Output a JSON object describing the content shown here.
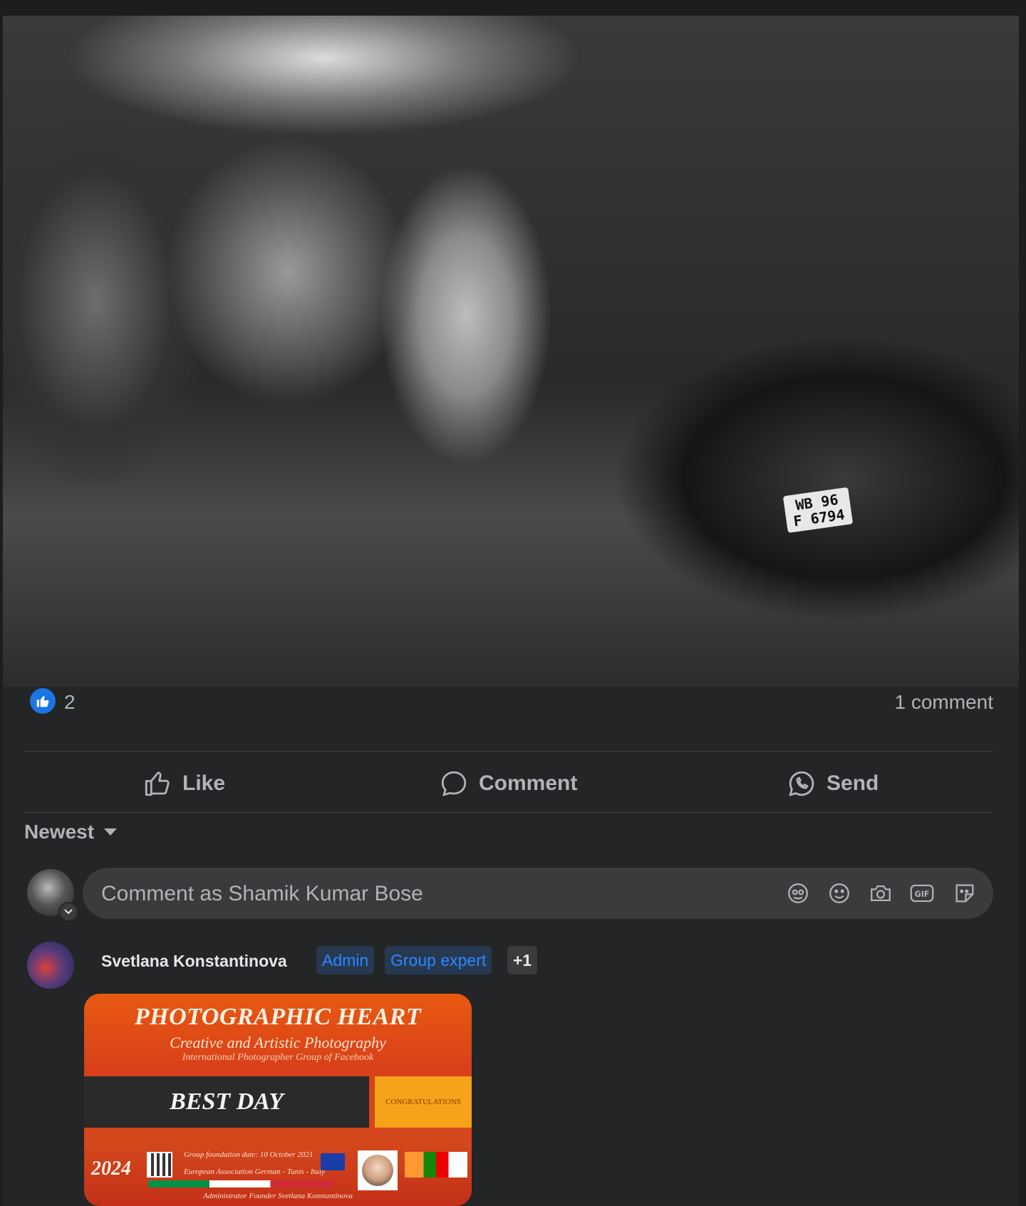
{
  "photo": {
    "plate_line1": "WB 96",
    "plate_line2": "F 6794"
  },
  "stats": {
    "reaction_count": "2",
    "comment_count": "1 comment"
  },
  "actions": {
    "like": "Like",
    "comment": "Comment",
    "send": "Send"
  },
  "sort": {
    "label": "Newest"
  },
  "composer": {
    "placeholder": "Comment as Shamik Kumar Bose",
    "icons": [
      "avatar-sticker-icon",
      "emoji-icon",
      "camera-icon",
      "gif-icon",
      "sticker-icon"
    ]
  },
  "comment": {
    "author": "Svetlana Konstantinova",
    "badges": [
      "Admin",
      "Group expert",
      "+1"
    ],
    "sticker": {
      "title": "PHOTOGRAPHIC HEART",
      "subtitle": "Creative and Artistic Photography",
      "subtitle2": "International Photographer Group of Facebook",
      "band": "BEST DAY",
      "side": "CONGRATULATIONS",
      "year": "2024",
      "founded": "Group foundation date: 10 October 2021",
      "association": "European Association German - Tunis - Italy",
      "admin": "Administrator Founder Svetlana Konstantinova"
    }
  },
  "colors": {
    "background": "#242526",
    "like_blue": "#1b74e4",
    "badge_blue": "#2d88ff",
    "sticker_orange": "#e85a10"
  }
}
